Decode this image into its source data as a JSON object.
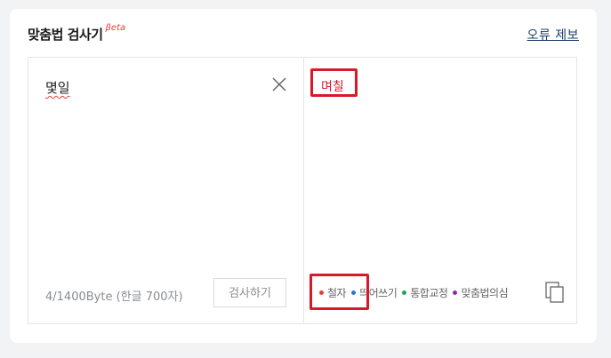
{
  "header": {
    "title": "맞춤법 검사기",
    "badge": "βeta",
    "report_link": "오류 제보"
  },
  "input_pane": {
    "text": "몇일",
    "byte_count": "4/1400Byte (한글 700자)",
    "check_button": "검사하기",
    "clear_icon": "close-icon"
  },
  "result_pane": {
    "text": "며칠",
    "legend": [
      {
        "label": "철자",
        "color": "#e0413b"
      },
      {
        "label": "띄어쓰기",
        "color": "#2f6fdc"
      },
      {
        "label": "통합교정",
        "color": "#1aa84a"
      },
      {
        "label": "맞춤법의심",
        "color": "#8e2ca8"
      }
    ],
    "copy_icon": "copy-icon"
  },
  "colors": {
    "highlight_border": "#d8192a",
    "error_text": "#d8192a",
    "link": "#1f3f6e"
  }
}
